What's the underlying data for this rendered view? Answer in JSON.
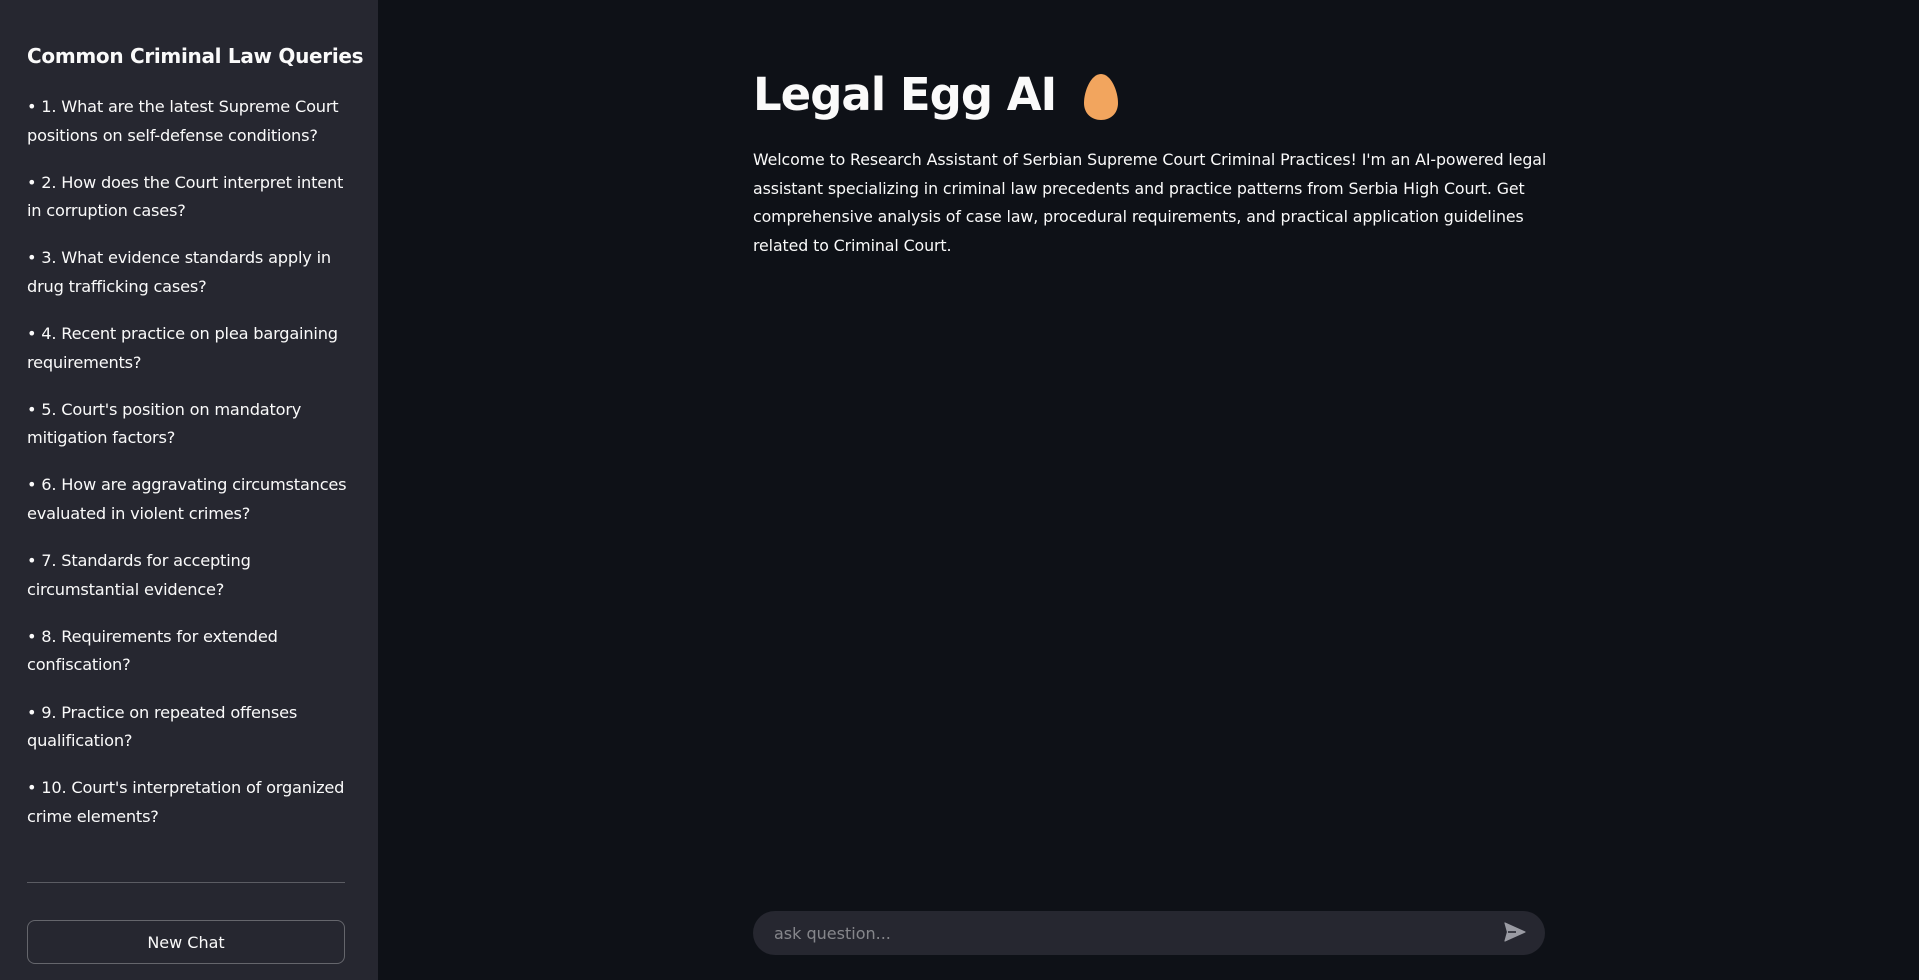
{
  "sidebar": {
    "title": "Common Criminal Law Queries",
    "queries": [
      "• 1. What are the latest Supreme Court positions on self-defense conditions?",
      "• 2. How does the Court interpret intent in corruption cases?",
      "• 3. What evidence standards apply in drug trafficking cases?",
      "• 4. Recent practice on plea bargaining requirements?",
      "• 5. Court's position on mandatory mitigation factors?",
      "• 6. How are aggravating circumstances evaluated in violent crimes?",
      "• 7. Standards for accepting circumstantial evidence?",
      "• 8. Requirements for extended confiscation?",
      "• 9. Practice on repeated offenses qualification?",
      "• 10. Court's interpretation of organized crime elements?"
    ],
    "new_chat_label": "New Chat"
  },
  "main": {
    "title": "Legal Egg AI",
    "title_icon": "egg-icon",
    "welcome": "Welcome to Research Assistant of Serbian Supreme Court Criminal Practices! I'm an AI-powered legal assistant specializing in criminal law precedents and practice patterns from Serbia High Court. Get comprehensive analysis of case law, procedural requirements, and practical application guidelines related to Criminal Court."
  },
  "chat_input": {
    "placeholder": "ask question...",
    "value": "",
    "send_icon": "send-icon"
  },
  "colors": {
    "background": "#0e1117",
    "sidebar": "#262730",
    "text": "#fafafa",
    "egg": "#f2a55e"
  }
}
